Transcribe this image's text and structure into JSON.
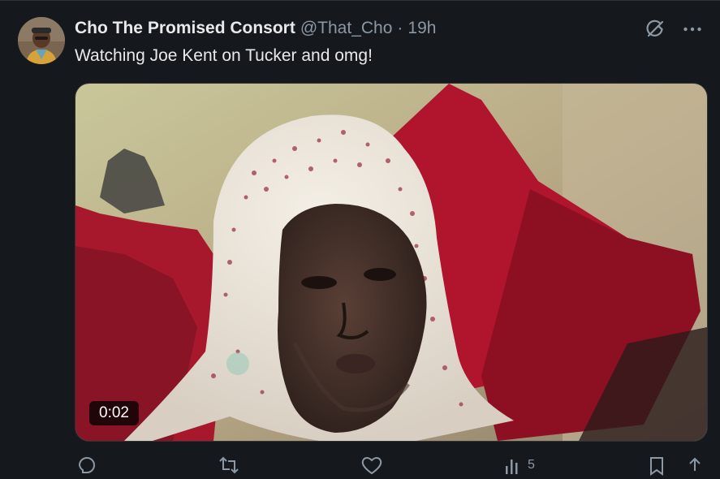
{
  "tweet": {
    "display_name": "Cho The Promised Consort",
    "handle": "@That_Cho",
    "separator": "·",
    "time": "19h",
    "text": "Watching Joe Kent on Tucker and omg!"
  },
  "media": {
    "duration": "0:02"
  },
  "actions": {
    "views_count": "5"
  },
  "colors": {
    "background": "#15181c",
    "text_primary": "#e7e9ea",
    "text_secondary": "#8b98a5",
    "border": "#2f3336"
  },
  "icons": {
    "grok": "grok-icon",
    "more": "more-icon",
    "reply": "reply-icon",
    "retweet": "retweet-icon",
    "like": "like-icon",
    "views": "views-icon",
    "bookmark": "bookmark-icon",
    "share": "share-icon"
  }
}
